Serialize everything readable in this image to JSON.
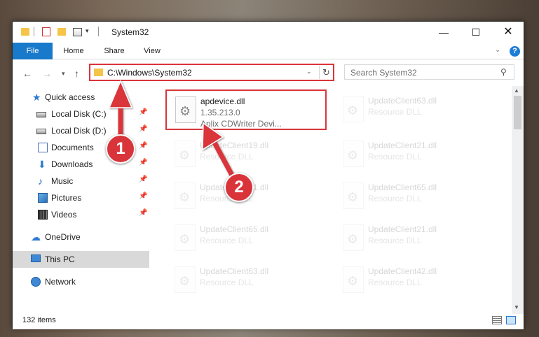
{
  "window": {
    "title": "System32",
    "minimize_glyph": "—",
    "maximize_glyph": "☐",
    "close_glyph": "✕"
  },
  "ribbon": {
    "tabs": [
      {
        "label": "File",
        "active": true
      },
      {
        "label": "Home"
      },
      {
        "label": "Share"
      },
      {
        "label": "View"
      }
    ],
    "help_label": "?"
  },
  "address": {
    "path": "C:\\Windows\\System32",
    "search_placeholder": "Search System32"
  },
  "nav": {
    "items": [
      {
        "label": "Quick access",
        "icon": "star-icon"
      },
      {
        "label": "Local Disk (C:)",
        "icon": "drive-icon",
        "pinned": true
      },
      {
        "label": "Local Disk (D:)",
        "icon": "drive-icon",
        "pinned": true
      },
      {
        "label": "Documents",
        "icon": "documents-icon",
        "pinned": true
      },
      {
        "label": "Downloads",
        "icon": "download-icon",
        "pinned": true
      },
      {
        "label": "Music",
        "icon": "music-icon",
        "pinned": true
      },
      {
        "label": "Pictures",
        "icon": "pictures-icon",
        "pinned": true
      },
      {
        "label": "Videos",
        "icon": "videos-icon",
        "pinned": true
      },
      {
        "label": "OneDrive",
        "icon": "cloud-icon"
      },
      {
        "label": "This PC",
        "icon": "computer-icon",
        "selected": true
      },
      {
        "label": "Network",
        "icon": "network-icon"
      }
    ]
  },
  "files": [
    {
      "name": "apdevice.dll",
      "version": "1.35.213.0",
      "description": "Aplix CDWriter Devi...",
      "highlighted": true
    },
    {
      "name": "UpdateClient63.dll",
      "type": "Resource DLL"
    },
    {
      "name": "UpdateClient19.dll",
      "type": "Resource DLL"
    },
    {
      "name": "UpdateClient21.dll",
      "type": "Resource DLL"
    },
    {
      "name": "UpdateClient21.dll",
      "type": "Resource DLL"
    },
    {
      "name": "UpdateClient65.dll",
      "type": "Resource DLL"
    },
    {
      "name": "UpdateClient65.dll",
      "type": "Resource DLL"
    },
    {
      "name": "UpdateClient21.dll",
      "type": "Resource DLL"
    },
    {
      "name": "UpdateClient63.dll",
      "type": "Resource DLL"
    },
    {
      "name": "UpdateClient42.dll",
      "type": "Resource DLL"
    }
  ],
  "status": {
    "item_count": "132 items"
  },
  "annotations": {
    "step1": "1",
    "step2": "2",
    "color": "#d9343a"
  }
}
